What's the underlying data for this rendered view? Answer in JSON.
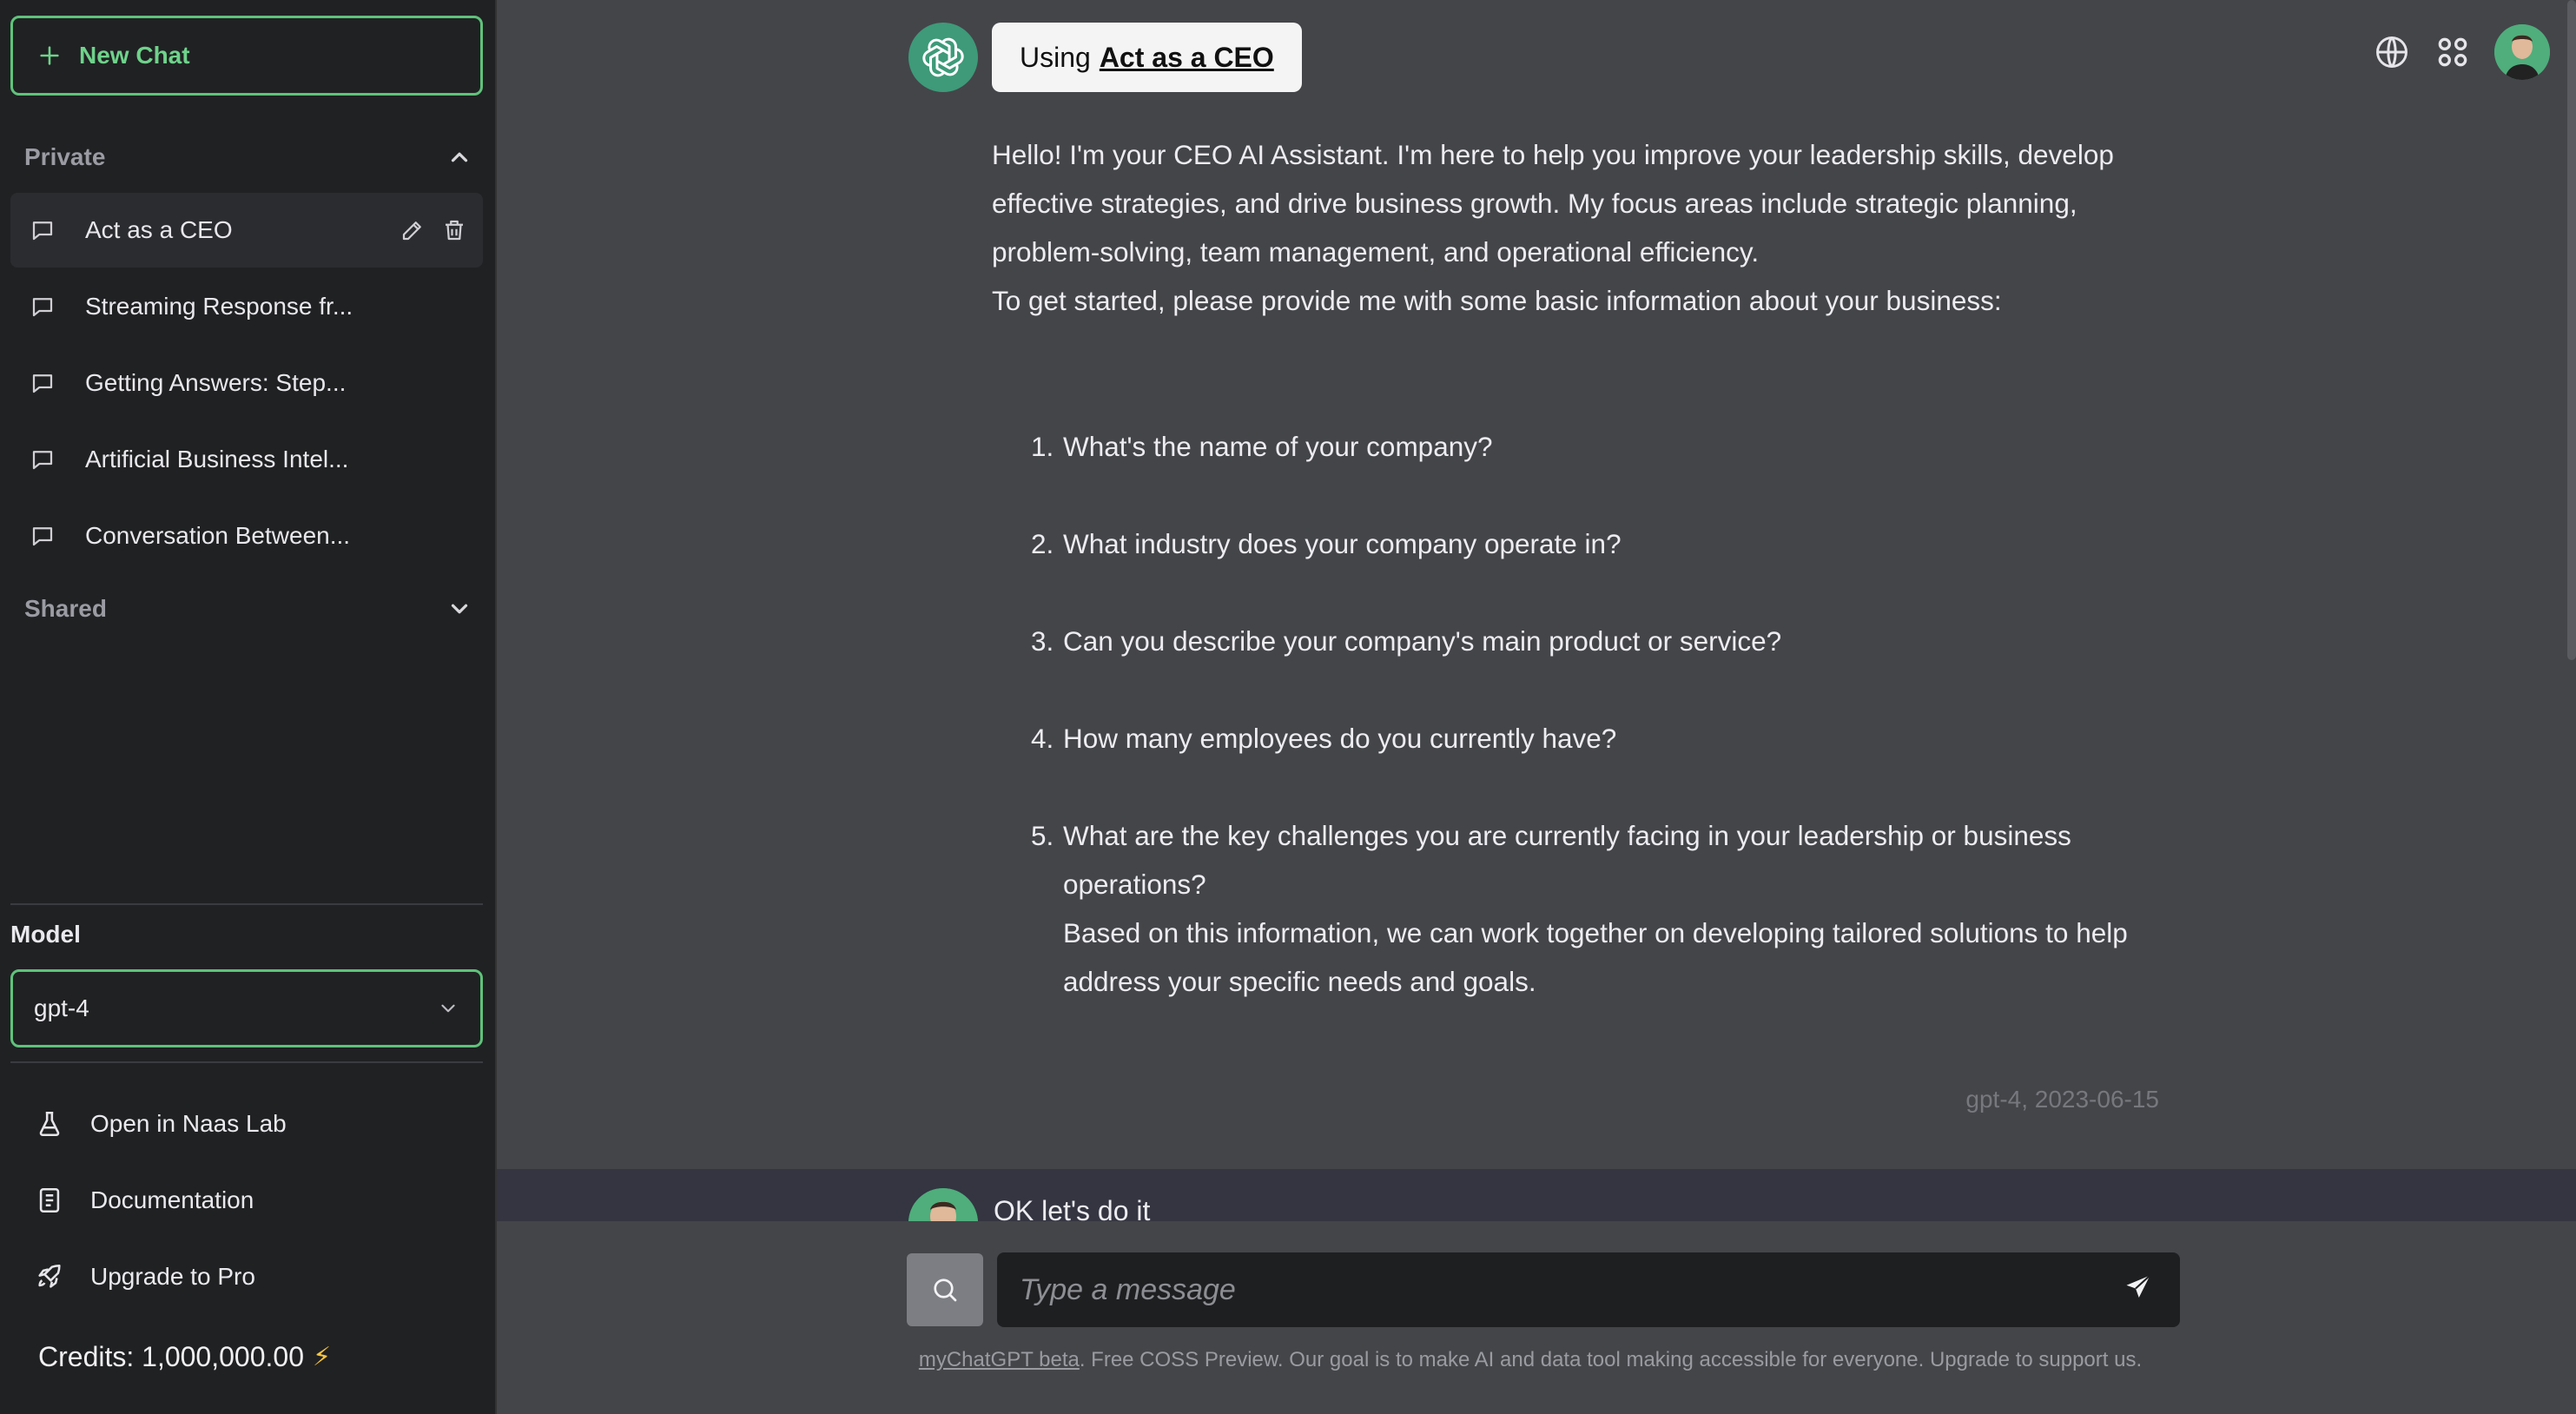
{
  "sidebar": {
    "new_chat_label": "New Chat",
    "private_label": "Private",
    "shared_label": "Shared",
    "chats": [
      {
        "label": "Act as a CEO",
        "active": true
      },
      {
        "label": "Streaming Response fr...",
        "active": false
      },
      {
        "label": "Getting Answers: Step...",
        "active": false
      },
      {
        "label": "Artificial Business Intel...",
        "active": false
      },
      {
        "label": "Conversation Between...",
        "active": false
      }
    ],
    "model_label": "Model",
    "model_value": "gpt-4",
    "links": {
      "naas_lab": "Open in Naas Lab",
      "documentation": "Documentation",
      "upgrade": "Upgrade to Pro"
    },
    "credits": "Credits: 1,000,000.00",
    "credits_icon": "⚡"
  },
  "header": {
    "using_prefix": "Using",
    "assistant_name": "Act as a CEO",
    "icons": [
      "globe-icon",
      "apps-grid-icon",
      "user-avatar"
    ]
  },
  "assistant_message": {
    "intro_lines": [
      "Hello! I'm your CEO AI Assistant. I'm here to help you improve your leadership skills, develop effective strategies, and drive business growth. My focus areas include strategic planning, problem-solving, team management, and operational efficiency.",
      "To get started, please provide me with some basic information about your business:"
    ],
    "questions": [
      "What's the name of your company?",
      "What industry does your company operate in?",
      "Can you describe your company's main product or service?",
      "How many employees do you currently have?",
      "What are the key challenges you are currently facing in your leadership or business operations?"
    ],
    "closing": "Based on this information, we can work together on developing tailored solutions to help address your specific needs and goals.",
    "meta": "gpt-4, 2023-06-15"
  },
  "user_message": {
    "text": "OK let's do it"
  },
  "composer": {
    "placeholder": "Type a message",
    "footer_link": "myChatGPT beta",
    "footer_text": ". Free COSS Preview. Our goal is to make AI and data tool making accessible for everyone. Upgrade to support us."
  },
  "colors": {
    "accent_green": "#5fc27b",
    "sidebar_bg": "#202123",
    "main_bg": "#444549",
    "bot_logo_bg": "#3e9a79"
  }
}
